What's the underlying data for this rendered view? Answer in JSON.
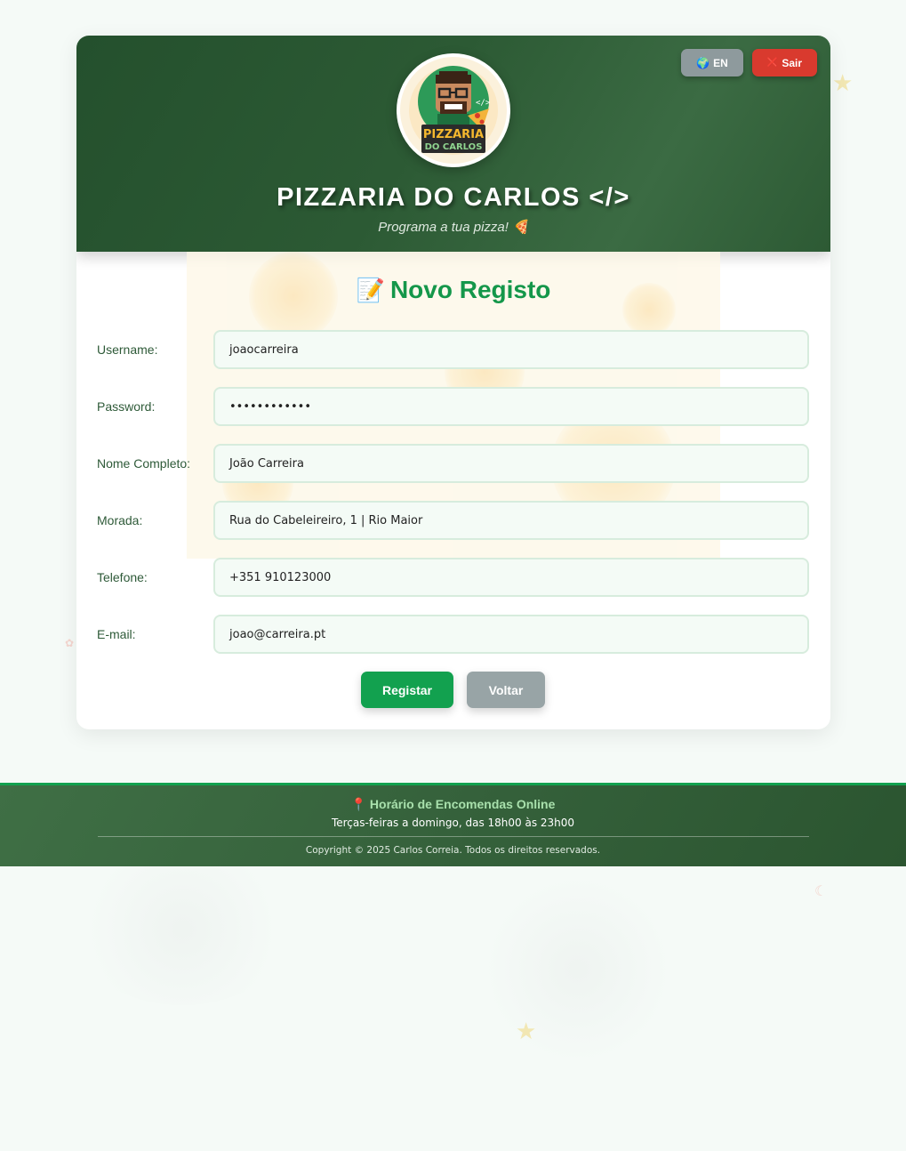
{
  "header": {
    "site_title": "PIZZARIA DO CARLOS </>",
    "subtitle": "Programa a tua pizza! 🍕",
    "logo": {
      "icon": "pizzaria-logo",
      "line1": "PIZZARIA",
      "line2": "DO CARLOS",
      "code_tag": "</>"
    },
    "lang_button": {
      "icon": "globe-icon",
      "glyph": "🌍",
      "label": "EN"
    },
    "exit_button": {
      "icon": "cross-icon",
      "glyph": "❌",
      "label": "Sair"
    }
  },
  "form": {
    "title_icon": "📝",
    "title": "Novo Registo",
    "fields": [
      {
        "label": "Username:",
        "value": "joaocarreira"
      },
      {
        "label": "Password:",
        "value": "••••••••••••"
      },
      {
        "label": "Nome Completo:",
        "value": "João Carreira"
      },
      {
        "label": "Morada:",
        "value": "Rua do Cabeleireiro, 1 | Rio Maior"
      },
      {
        "label": "Telefone:",
        "value": "+351 910123000"
      },
      {
        "label": "E-mail:",
        "value": "joao@carreira.pt"
      }
    ],
    "register_label": "Registar",
    "back_label": "Voltar"
  },
  "footer": {
    "pin_icon": "📍",
    "title": "Horário de Encomendas Online",
    "hours": "Terças-feiras a domingo, das 18h00 às 23h00",
    "copyright": "Copyright © 2025 Carlos Correia. Todos os direitos reservados."
  },
  "colors": {
    "header_green": "#2c5a34",
    "accent_green": "#14974a",
    "exit_red": "#d93a2e",
    "neutral_gray": "#8e9a9d"
  }
}
